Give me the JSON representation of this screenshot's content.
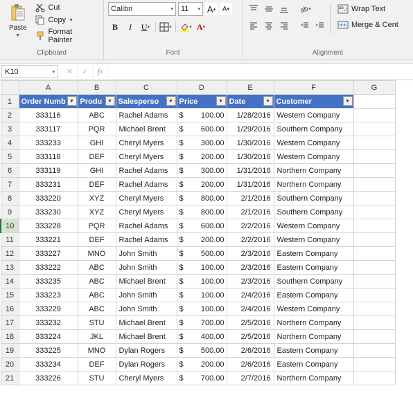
{
  "ribbon": {
    "clipboard": {
      "paste": "Paste",
      "cut": "Cut",
      "copy": "Copy",
      "format_painter": "Format Painter",
      "label": "Clipboard"
    },
    "font": {
      "name": "Calibri",
      "size": "11",
      "label": "Font"
    },
    "alignment": {
      "wrap": "Wrap Text",
      "merge": "Merge & Cent",
      "label": "Alignment"
    }
  },
  "namebox": "K10",
  "columns": [
    "A",
    "B",
    "C",
    "D",
    "E",
    "F",
    "G"
  ],
  "headers": [
    "Order Numb",
    "Produ",
    "Salesperso",
    "Price",
    "Date",
    "Customer"
  ],
  "selected_row": 10,
  "rows": [
    {
      "n": 1,
      "order": "333116",
      "prod": "ABC",
      "sales": "Rachel Adams",
      "price": "100.00",
      "date": "1/28/2016",
      "cust": "Western Company"
    },
    {
      "n": 2,
      "order": "333117",
      "prod": "PQR",
      "sales": "Michael Brent",
      "price": "600.00",
      "date": "1/29/2016",
      "cust": "Southern Company"
    },
    {
      "n": 3,
      "order": "333233",
      "prod": "GHI",
      "sales": "Cheryl Myers",
      "price": "300.00",
      "date": "1/30/2016",
      "cust": "Western Company"
    },
    {
      "n": 4,
      "order": "333118",
      "prod": "DEF",
      "sales": "Cheryl Myers",
      "price": "200.00",
      "date": "1/30/2016",
      "cust": "Western Company"
    },
    {
      "n": 5,
      "order": "333119",
      "prod": "GHI",
      "sales": "Rachel Adams",
      "price": "300.00",
      "date": "1/31/2016",
      "cust": "Northern Company"
    },
    {
      "n": 6,
      "order": "333231",
      "prod": "DEF",
      "sales": "Rachel Adams",
      "price": "200.00",
      "date": "1/31/2016",
      "cust": "Northern Company"
    },
    {
      "n": 7,
      "order": "333220",
      "prod": "XYZ",
      "sales": "Cheryl Myers",
      "price": "800.00",
      "date": "2/1/2016",
      "cust": "Southern Company"
    },
    {
      "n": 8,
      "order": "333230",
      "prod": "XYZ",
      "sales": "Cheryl Myers",
      "price": "800.00",
      "date": "2/1/2016",
      "cust": "Southern Company"
    },
    {
      "n": 9,
      "order": "333228",
      "prod": "PQR",
      "sales": "Rachel Adams",
      "price": "600.00",
      "date": "2/2/2016",
      "cust": "Western Company"
    },
    {
      "n": 10,
      "order": "333221",
      "prod": "DEF",
      "sales": "Rachel Adams",
      "price": "200.00",
      "date": "2/2/2016",
      "cust": "Western Company"
    },
    {
      "n": 11,
      "order": "333227",
      "prod": "MNO",
      "sales": "John Smith",
      "price": "500.00",
      "date": "2/3/2016",
      "cust": "Eastern Company"
    },
    {
      "n": 12,
      "order": "333222",
      "prod": "ABC",
      "sales": "John Smith",
      "price": "100.00",
      "date": "2/3/2016",
      "cust": "Eastern Company"
    },
    {
      "n": 13,
      "order": "333235",
      "prod": "ABC",
      "sales": "Michael Brent",
      "price": "100.00",
      "date": "2/3/2016",
      "cust": "Southern Company"
    },
    {
      "n": 14,
      "order": "333223",
      "prod": "ABC",
      "sales": "John Smith",
      "price": "100.00",
      "date": "2/4/2016",
      "cust": "Eastern Company"
    },
    {
      "n": 15,
      "order": "333229",
      "prod": "ABC",
      "sales": "John Smith",
      "price": "100.00",
      "date": "2/4/2016",
      "cust": "Western Company"
    },
    {
      "n": 16,
      "order": "333232",
      "prod": "STU",
      "sales": "Michael Brent",
      "price": "700.00",
      "date": "2/5/2016",
      "cust": "Northern Company"
    },
    {
      "n": 17,
      "order": "333224",
      "prod": "JKL",
      "sales": "Michael Brent",
      "price": "400.00",
      "date": "2/5/2016",
      "cust": "Northern Company"
    },
    {
      "n": 18,
      "order": "333225",
      "prod": "MNO",
      "sales": "Dylan Rogers",
      "price": "500.00",
      "date": "2/6/2016",
      "cust": "Eastern Company"
    },
    {
      "n": 19,
      "order": "333234",
      "prod": "DEF",
      "sales": "Dylan Rogers",
      "price": "200.00",
      "date": "2/6/2016",
      "cust": "Eastern Company"
    },
    {
      "n": 20,
      "order": "333226",
      "prod": "STU",
      "sales": "Cheryl Myers",
      "price": "700.00",
      "date": "2/7/2016",
      "cust": "Northern Company"
    }
  ]
}
